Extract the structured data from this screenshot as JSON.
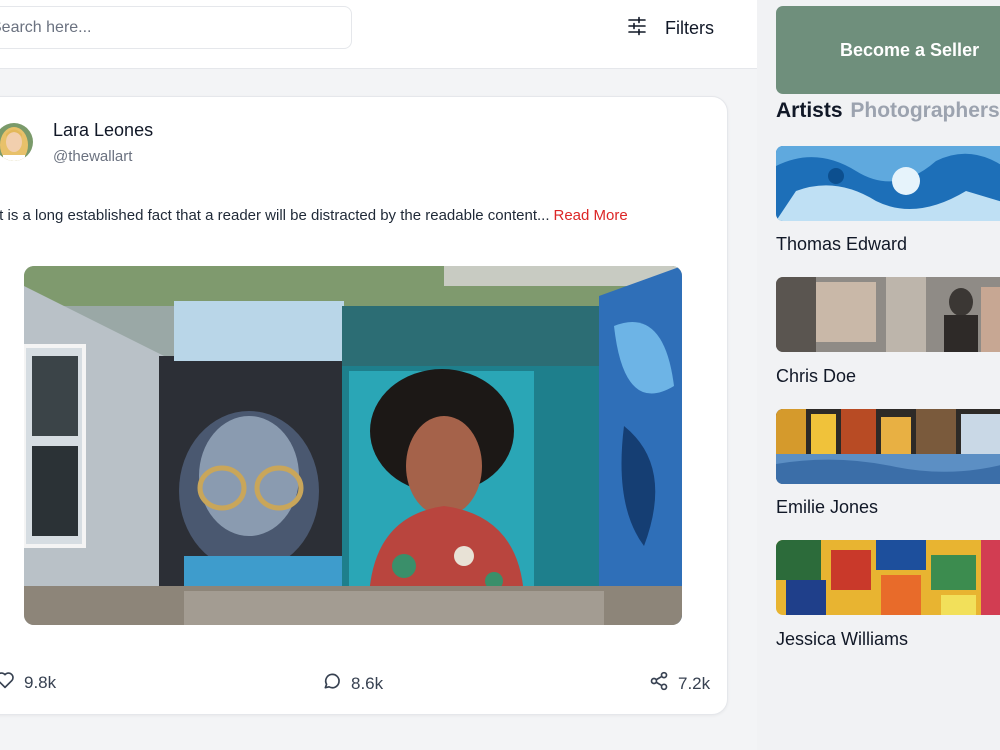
{
  "search": {
    "placeholder": "Search here..."
  },
  "toolbar": {
    "filters_label": "Filters",
    "filters_icon": "sliders-icon"
  },
  "post": {
    "author_name": "Lara Leones",
    "author_handle": "@thewallart",
    "text": "It is a long established fact that a reader will be distracted by the readable content...",
    "read_more": "Read More",
    "image": "street-art-mural",
    "likes": "9.8k",
    "comments": "8.6k",
    "shares": "7.2k"
  },
  "sidebar": {
    "cta_label": "Become a Seller",
    "tabs": [
      {
        "label": "Artists",
        "active": true
      },
      {
        "label": "Photographers",
        "active": false
      }
    ],
    "artists": [
      {
        "name": "Thomas Edward",
        "thumb": "blue-abstract"
      },
      {
        "name": "Chris Doe",
        "thumb": "street-painters"
      },
      {
        "name": "Emilie Jones",
        "thumb": "city-reflection"
      },
      {
        "name": "Jessica Williams",
        "thumb": "colorful-abstract"
      }
    ]
  },
  "colors": {
    "accent_red": "#dc2626",
    "seller_green": "#6f8f7c",
    "muted_tab": "#9ca3af"
  }
}
